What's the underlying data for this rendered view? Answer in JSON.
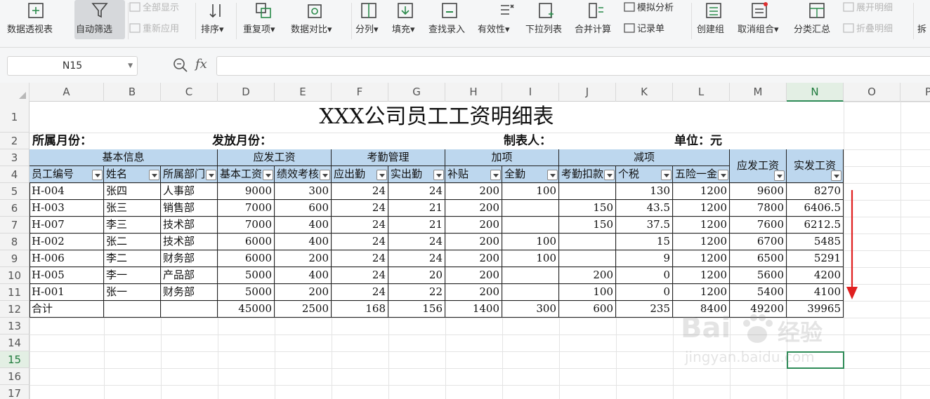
{
  "ribbon": {
    "items": [
      {
        "label": "数据透视表",
        "icon": "pivot-table-icon"
      },
      {
        "label": "自动筛选",
        "icon": "filter-icon",
        "active": true
      },
      {
        "label": "排序",
        "icon": "sort-icon",
        "dropdown": true
      },
      {
        "label": "重复项",
        "icon": "duplicate-icon",
        "dropdown": true
      },
      {
        "label": "数据对比",
        "icon": "compare-icon",
        "dropdown": true
      },
      {
        "label": "分列",
        "icon": "split-column-icon",
        "dropdown": true
      },
      {
        "label": "填充",
        "icon": "fill-icon",
        "dropdown": true
      },
      {
        "label": "查找录入",
        "icon": "lookup-icon"
      },
      {
        "label": "有效性",
        "icon": "validation-icon",
        "dropdown": true
      },
      {
        "label": "下拉列表",
        "icon": "dropdown-list-icon"
      },
      {
        "label": "合并计算",
        "icon": "consolidate-icon"
      },
      {
        "label": "创建组",
        "icon": "group-icon"
      },
      {
        "label": "取消组合",
        "icon": "ungroup-icon",
        "dropdown": true
      },
      {
        "label": "分类汇总",
        "icon": "subtotal-icon"
      },
      {
        "label": "拆",
        "icon": ""
      }
    ],
    "small_items": {
      "show_all": "全部显示",
      "reapply": "重新应用",
      "what_if": "模拟分析",
      "record_form": "记录单",
      "expand_detail": "展开明细",
      "collapse_detail": "折叠明细"
    }
  },
  "formula_bar": {
    "name_box": "N15",
    "fx": "fx",
    "formula": ""
  },
  "grid": {
    "columns": [
      "A",
      "B",
      "C",
      "D",
      "E",
      "F",
      "G",
      "H",
      "I",
      "J",
      "K",
      "L",
      "M",
      "N",
      "O",
      "P"
    ],
    "rows": [
      "1",
      "2",
      "3",
      "4",
      "5",
      "6",
      "7",
      "8",
      "9",
      "10",
      "11",
      "12",
      "13",
      "14",
      "15",
      "16",
      "17"
    ],
    "selected_cell": "N15"
  },
  "sheet": {
    "title": "XXX公司员工工资明细表",
    "info": {
      "month": "所属月份：",
      "pay_month": "发放月份：",
      "creator": "制表人：",
      "unit": "单位：元"
    },
    "group_headers": [
      "基本信息",
      "应发工资",
      "考勤管理",
      "加项",
      "减项"
    ],
    "merged_headers": [
      "应发工资",
      "实发工资"
    ],
    "column_headers": [
      "员工编号",
      "姓名",
      "所属部门",
      "基本工资",
      "绩效考核",
      "应出勤",
      "实出勤",
      "补贴",
      "全勤",
      "考勤扣款",
      "个税",
      "五险一金"
    ],
    "rows": [
      [
        "H-004",
        "张四",
        "人事部",
        "9000",
        "300",
        "24",
        "24",
        "200",
        "100",
        "",
        "130",
        "1200",
        "9600",
        "8270"
      ],
      [
        "H-003",
        "张三",
        "销售部",
        "7000",
        "600",
        "24",
        "21",
        "200",
        "",
        "150",
        "43.5",
        "1200",
        "7800",
        "6406.5"
      ],
      [
        "H-007",
        "李三",
        "技术部",
        "7000",
        "400",
        "24",
        "21",
        "200",
        "",
        "150",
        "37.5",
        "1200",
        "7600",
        "6212.5"
      ],
      [
        "H-002",
        "张二",
        "技术部",
        "6000",
        "400",
        "24",
        "24",
        "200",
        "100",
        "",
        "15",
        "1200",
        "6700",
        "5485"
      ],
      [
        "H-006",
        "李二",
        "财务部",
        "6000",
        "200",
        "24",
        "24",
        "200",
        "100",
        "",
        "9",
        "1200",
        "6500",
        "5291"
      ],
      [
        "H-005",
        "李一",
        "产品部",
        "5000",
        "400",
        "24",
        "20",
        "200",
        "",
        "200",
        "0",
        "1200",
        "5600",
        "4200"
      ],
      [
        "H-001",
        "张一",
        "财务部",
        "5000",
        "200",
        "24",
        "22",
        "200",
        "",
        "100",
        "0",
        "1200",
        "5400",
        "4100"
      ]
    ],
    "total_row": [
      "合计",
      "",
      "",
      "45000",
      "2500",
      "168",
      "156",
      "1400",
      "300",
      "600",
      "235",
      "8400",
      "49200",
      "39965"
    ]
  },
  "watermark": {
    "brand": "Bai",
    "brand_suffix": "经验",
    "url": "jingyan.baidu.com"
  },
  "colors": {
    "header_fill": "#bdd7ee",
    "selection": "#2e8b57",
    "arrow": "#e02020"
  }
}
